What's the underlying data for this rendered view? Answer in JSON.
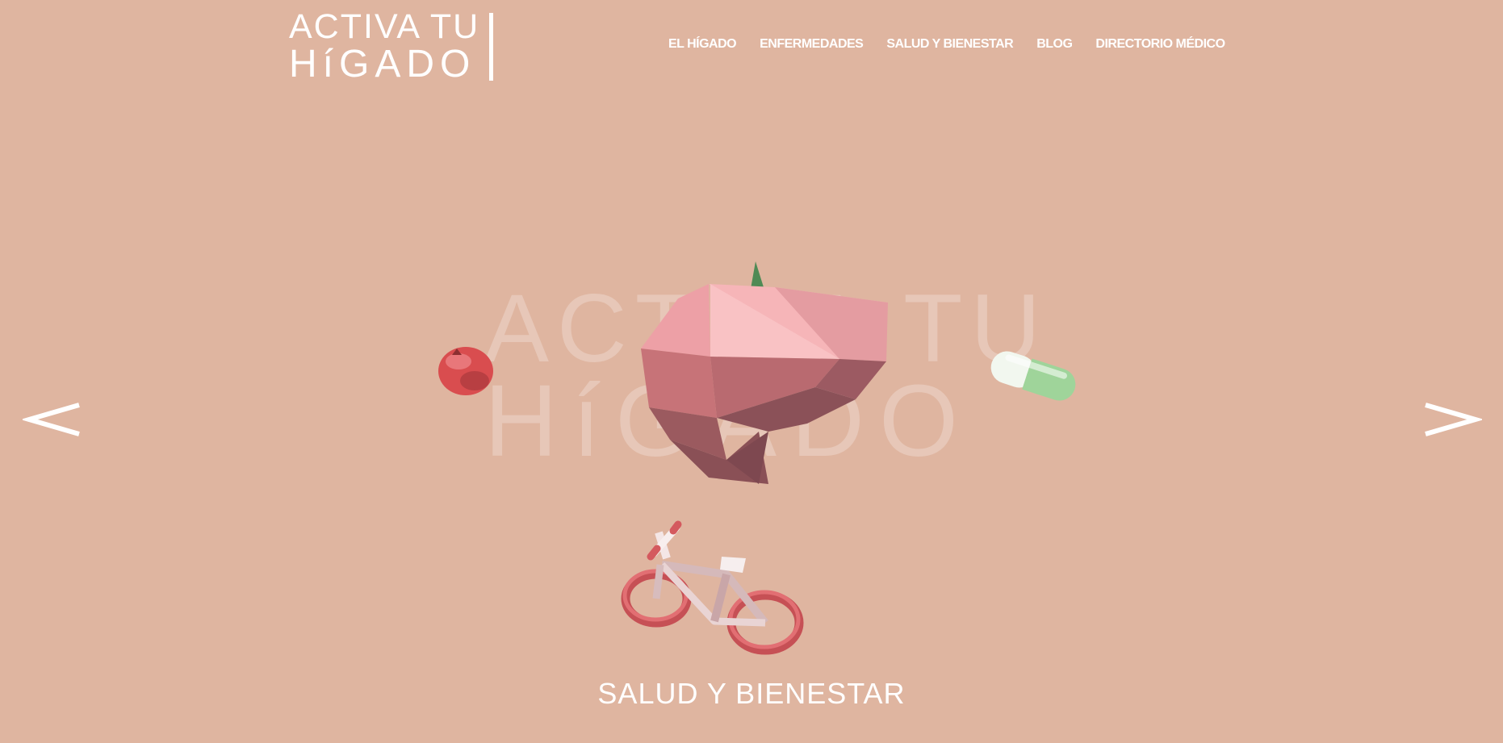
{
  "header": {
    "logo_line1": "ACTIVA TU",
    "logo_line2": "HíGADO",
    "nav": [
      {
        "label": "EL HÍGADO"
      },
      {
        "label": "ENFERMEDADES"
      },
      {
        "label": "SALUD Y BIENESTAR"
      },
      {
        "label": "BLOG"
      },
      {
        "label": "DIRECTORIO MÉDICO"
      }
    ]
  },
  "hero": {
    "bg_title_line1": "ACTIVA TU",
    "bg_title_line2": "HíGADO",
    "prev_icon": "chevron-left-icon",
    "next_icon": "chevron-right-icon",
    "caption": "SALUD Y BIENESTAR"
  },
  "colors": {
    "background": "#dfb5a0",
    "liver": "#c77378",
    "apple": "#d94d4f",
    "pill_white": "#f2f7ef",
    "pill_green": "#9fd49a",
    "bike_wheel": "#d4595e"
  }
}
